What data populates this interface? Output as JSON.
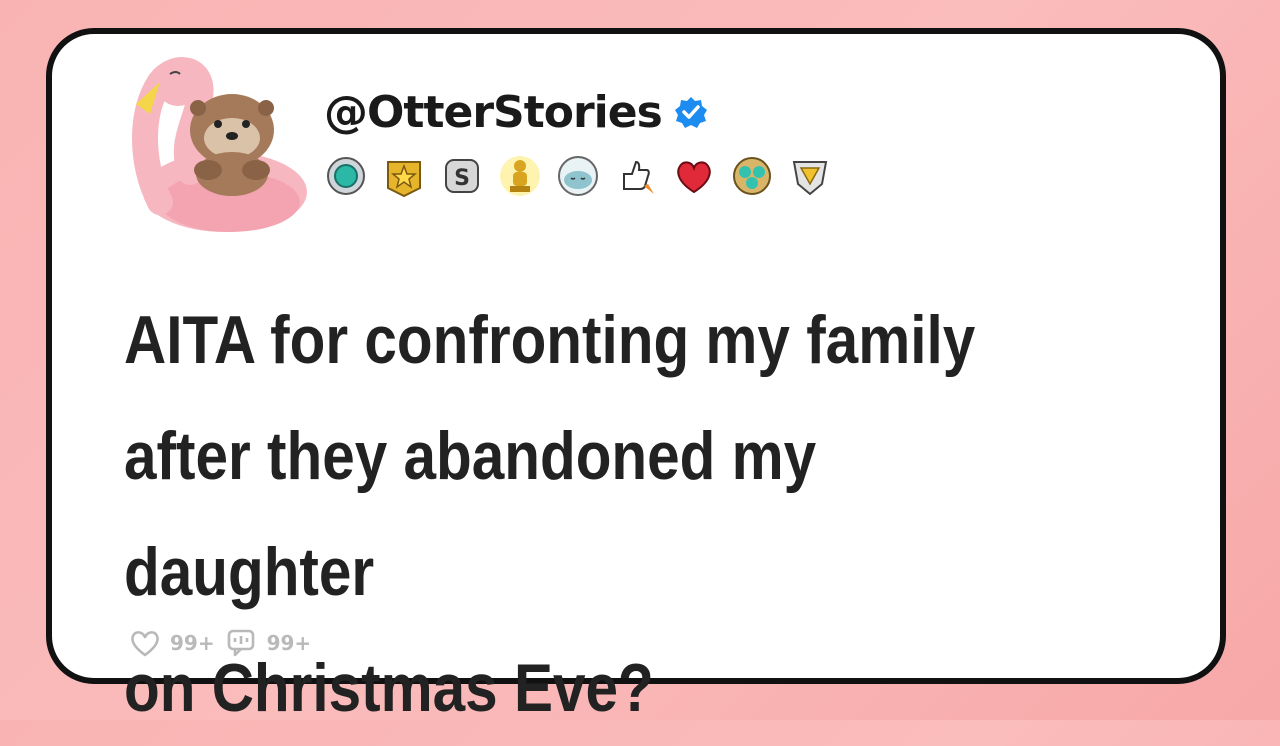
{
  "post": {
    "username": "@OtterStories",
    "verified": true,
    "avatar_icon": "otter-flamingo-floatie-avatar",
    "badges": [
      "teal-gem-badge-icon",
      "gold-star-badge-icon",
      "silver-s-badge-icon",
      "golden-trophy-figure-icon",
      "sleeping-seal-badge-icon",
      "rocket-thumbs-up-icon",
      "red-heart-badge-icon",
      "gem-cluster-badge-icon",
      "golden-diamond-shield-icon"
    ],
    "title_lines": [
      "AITA for confronting my family",
      "after they abandoned my daughter",
      "on Christmas Eve?"
    ],
    "likes": "99+",
    "comments": "99+"
  },
  "colors": {
    "background": "#f9b3b3",
    "card": "#ffffff",
    "border": "#111111",
    "verified": "#1d8cf0",
    "stats": "#b9b9b9"
  }
}
